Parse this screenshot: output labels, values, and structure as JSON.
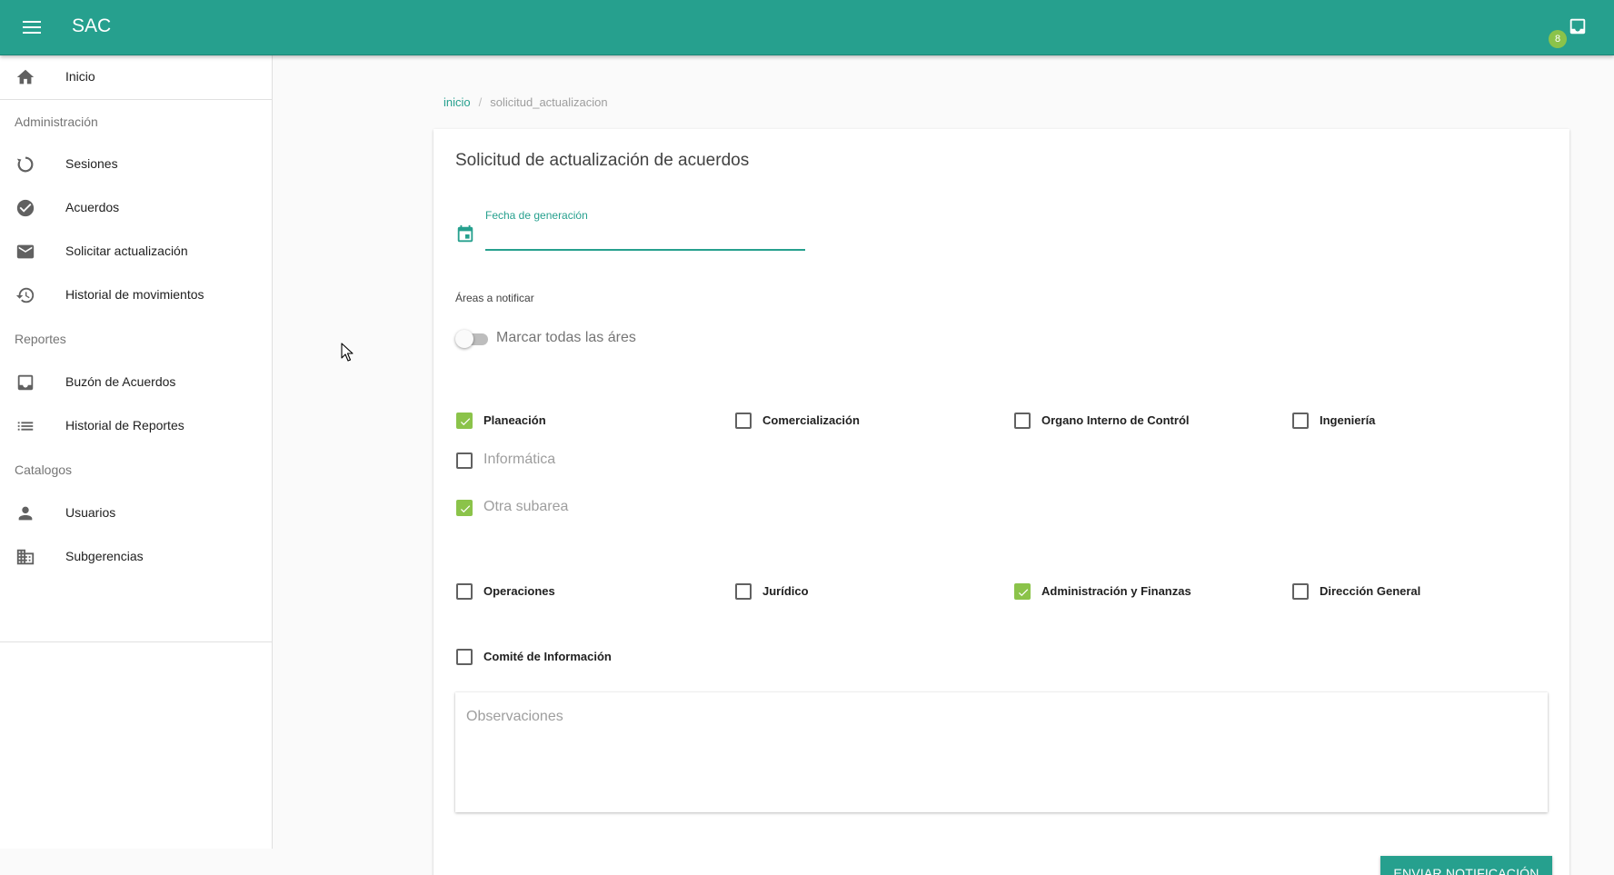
{
  "app": {
    "title": "SAC",
    "notification_count": "8"
  },
  "sidebar": {
    "home": {
      "label": "Inicio",
      "icon": "home-icon"
    },
    "sections": [
      {
        "title": "Administración",
        "items": [
          {
            "label": "Sesiones",
            "icon": "refresh-icon"
          },
          {
            "label": "Acuerdos",
            "icon": "check-circle-icon"
          },
          {
            "label": "Solicitar actualización",
            "icon": "mail-icon"
          },
          {
            "label": "Historial de movimientos",
            "icon": "history-icon"
          }
        ]
      },
      {
        "title": "Reportes",
        "items": [
          {
            "label": "Buzón de Acuerdos",
            "icon": "inbox-icon"
          },
          {
            "label": "Historial de Reportes",
            "icon": "list-icon"
          }
        ]
      },
      {
        "title": "Catalogos",
        "items": [
          {
            "label": "Usuarios",
            "icon": "person-icon"
          },
          {
            "label": "Subgerencias",
            "icon": "business-icon"
          }
        ]
      }
    ]
  },
  "breadcrumb": {
    "home": "inicio",
    "separator": "/",
    "current": "solicitud_actualizacion"
  },
  "form": {
    "title": "Solicitud de actualización de acuerdos",
    "date_field": {
      "label": "Fecha de generación",
      "value": ""
    },
    "areas_label": "Áreas a notificar",
    "toggle_all": {
      "label": "Marcar todas las áres",
      "checked": false
    },
    "areas": [
      {
        "label": "Planeación",
        "checked": true
      },
      {
        "label": "Comercialización",
        "checked": false
      },
      {
        "label": "Organo Interno de Contról",
        "checked": false
      },
      {
        "label": "Ingeniería",
        "checked": false
      },
      {
        "label": "Informática",
        "checked": false
      },
      {
        "label": "Otra subarea",
        "checked": true
      },
      {
        "label": "Operaciones",
        "checked": false
      },
      {
        "label": "Jurídico",
        "checked": false
      },
      {
        "label": "Administración y Finanzas",
        "checked": true
      },
      {
        "label": "Dirección General",
        "checked": false
      },
      {
        "label": "Comité de Información",
        "checked": false
      }
    ],
    "observations_placeholder": "Observaciones",
    "submit_label": "ENVIAR NOTIFICACIÓN"
  },
  "colors": {
    "primary": "#26a08e",
    "accent": "#8bc34a"
  }
}
